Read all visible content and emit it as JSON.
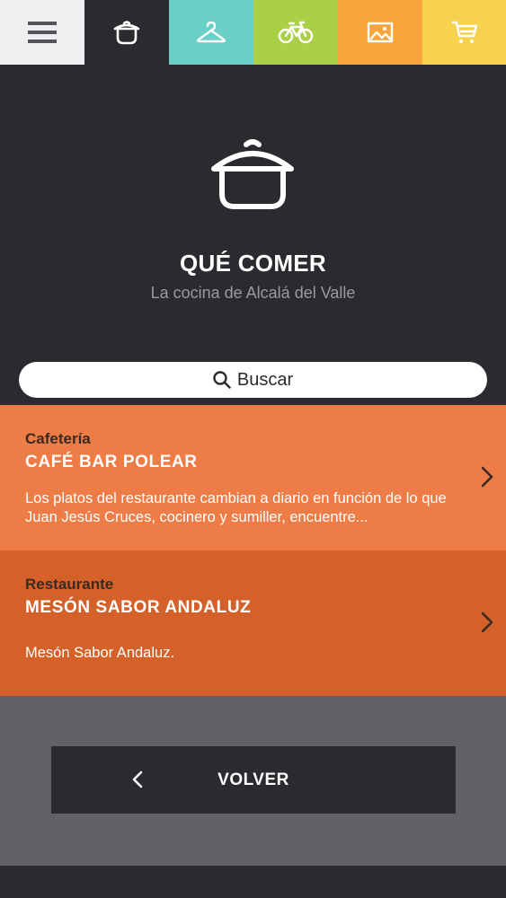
{
  "tabs": [
    {
      "icon": "menu-icon",
      "color": "#efeef0"
    },
    {
      "icon": "pot-icon",
      "color": "#2b2a2f"
    },
    {
      "icon": "hanger-icon",
      "color": "#6ccfc7"
    },
    {
      "icon": "bicycle-icon",
      "color": "#a9d046"
    },
    {
      "icon": "image-icon",
      "color": "#f9a43a"
    },
    {
      "icon": "cart-icon",
      "color": "#f6d24e"
    }
  ],
  "header": {
    "title": "QUÉ COMER",
    "subtitle": "La cocina de Alcalá del Valle",
    "icon": "pot-icon"
  },
  "search": {
    "label": "Buscar",
    "icon": "search-icon"
  },
  "items": [
    {
      "category": "Cafetería",
      "name": "CAFÉ BAR POLEAR",
      "description": "Los platos del restaurante cambian a diario en función de lo que Juan Jesús Cruces, cocinero y sumiller, encuentre...",
      "color": "#ed7c46"
    },
    {
      "category": "Restaurante",
      "name": "MESÓN SABOR ANDALUZ",
      "description": "Mesón Sabor Andaluz.",
      "color": "#d4612a"
    }
  ],
  "back": {
    "label": "VOLVER",
    "icon": "chevron-left-icon"
  },
  "colors": {
    "dark": "#2b2a2f",
    "gray": "#636166"
  }
}
